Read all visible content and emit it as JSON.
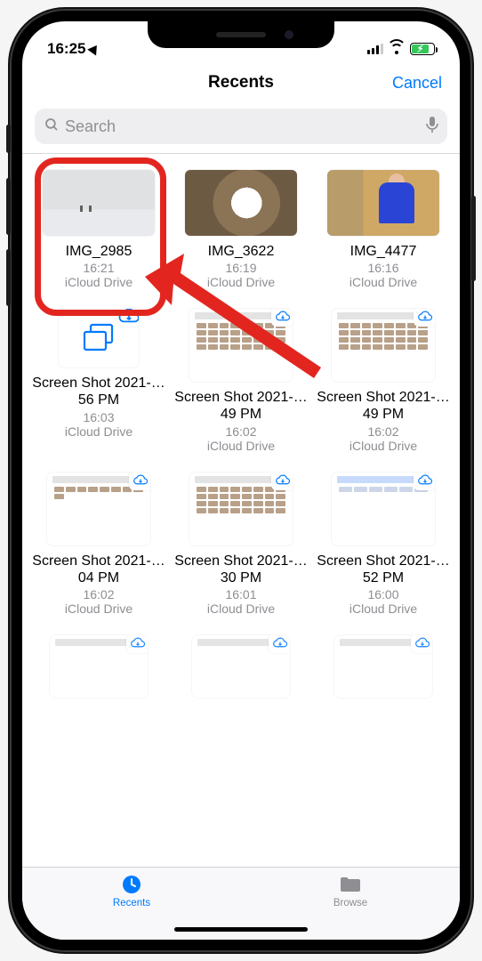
{
  "status": {
    "time": "16:25"
  },
  "nav": {
    "title": "Recents",
    "cancel": "Cancel"
  },
  "search": {
    "placeholder": "Search"
  },
  "files": [
    {
      "name": "IMG_2985",
      "time": "16:21",
      "loc": "iCloud Drive",
      "thumb": "snow",
      "highlighted": true
    },
    {
      "name": "IMG_3622",
      "time": "16:19",
      "loc": "iCloud Drive",
      "thumb": "dog"
    },
    {
      "name": "IMG_4477",
      "time": "16:16",
      "loc": "iCloud Drive",
      "thumb": "guy"
    },
    {
      "name": "Screen Shot 2021-…56 PM",
      "time": "16:03",
      "loc": "iCloud Drive",
      "thumb": "generic",
      "cloud": true
    },
    {
      "name": "Screen Shot 2021-…49 PM",
      "time": "16:02",
      "loc": "iCloud Drive",
      "thumb": "shot",
      "cloud": true
    },
    {
      "name": "Screen Shot 2021-…49 PM",
      "time": "16:02",
      "loc": "iCloud Drive",
      "thumb": "shot",
      "cloud": true
    },
    {
      "name": "Screen Shot 2021-…04 PM",
      "time": "16:02",
      "loc": "iCloud Drive",
      "thumb": "shot_sparse",
      "cloud": true
    },
    {
      "name": "Screen Shot 2021-…30 PM",
      "time": "16:01",
      "loc": "iCloud Drive",
      "thumb": "shot",
      "cloud": true
    },
    {
      "name": "Screen Shot 2021-…52 PM",
      "time": "16:00",
      "loc": "iCloud Drive",
      "thumb": "shot_blue",
      "cloud": true
    }
  ],
  "tabs": {
    "recents": "Recents",
    "browse": "Browse"
  }
}
